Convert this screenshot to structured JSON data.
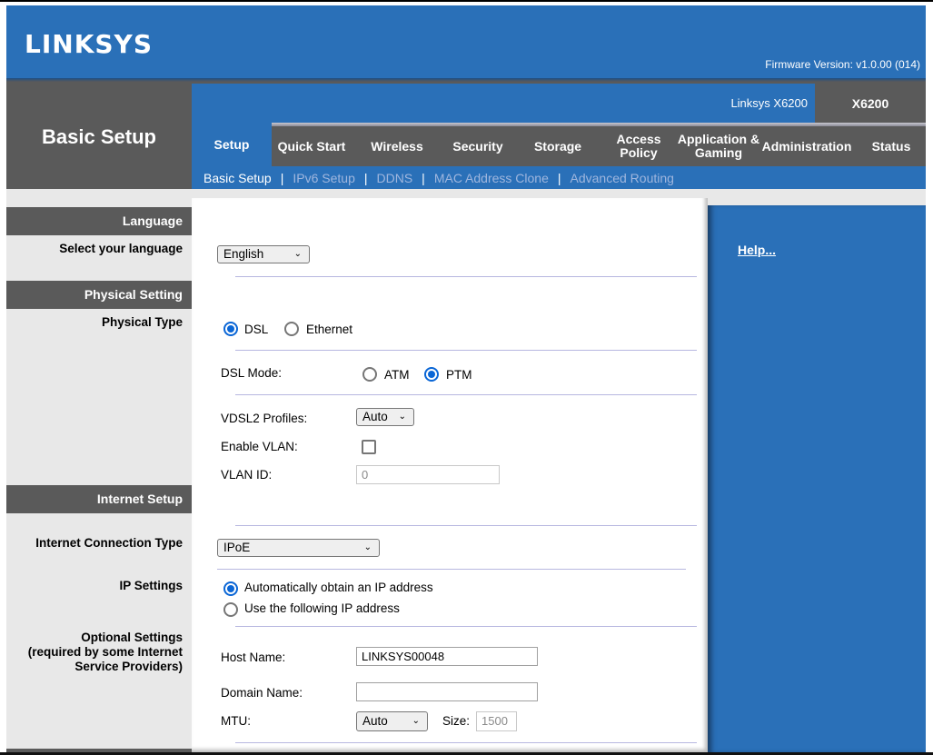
{
  "header": {
    "brand": "LINKSYS",
    "firmware": "Firmware Version: v1.0.00 (014)",
    "page_title": "Basic Setup",
    "model_name": "Linksys X6200",
    "model_short": "X6200"
  },
  "tabs": [
    {
      "label": "Setup",
      "active": true
    },
    {
      "label": "Quick Start"
    },
    {
      "label": "Wireless"
    },
    {
      "label": "Security"
    },
    {
      "label": "Storage"
    },
    {
      "label": "Access Policy"
    },
    {
      "label": "Application & Gaming"
    },
    {
      "label": "Administration"
    },
    {
      "label": "Status"
    }
  ],
  "subnav": [
    {
      "label": "Basic Setup",
      "current": true
    },
    {
      "label": "IPv6 Setup"
    },
    {
      "label": "DDNS"
    },
    {
      "label": "MAC Address Clone"
    },
    {
      "label": "Advanced Routing"
    }
  ],
  "subnav_sep": "|",
  "sections": {
    "language": "Language",
    "physical": "Physical Setting",
    "internet": "Internet Setup"
  },
  "labels": {
    "select_language": "Select your language",
    "physical_type": "Physical Type",
    "connection_type": "Internet Connection Type",
    "ip_settings": "IP Settings",
    "optional_1": "Optional Settings",
    "optional_2": "(required by some Internet",
    "optional_3": "Service Providers)"
  },
  "form": {
    "language": "English",
    "physical_type": {
      "options": [
        "DSL",
        "Ethernet"
      ],
      "selected": "DSL"
    },
    "dsl_mode_label": "DSL Mode:",
    "dsl_mode": {
      "options": [
        "ATM",
        "PTM"
      ],
      "selected": "PTM"
    },
    "vdsl2_label": "VDSL2 Profiles:",
    "vdsl2_value": "Auto",
    "enable_vlan_label": "Enable VLAN:",
    "enable_vlan": false,
    "vlan_id_label": "VLAN ID:",
    "vlan_id": "0",
    "connection_type": "IPoE",
    "ip_settings": {
      "options": [
        "Automatically obtain an IP address",
        "Use the following IP address"
      ],
      "selected": "Automatically obtain an IP address"
    },
    "host_name_label": "Host Name:",
    "host_name": "LINKSYS00048",
    "domain_name_label": "Domain Name:",
    "domain_name": "",
    "mtu_label": "MTU:",
    "mtu_value": "Auto",
    "size_label": "Size:",
    "size_value": "1500"
  },
  "help": {
    "link": "Help..."
  },
  "colors": {
    "brand_blue": "#2a70b8",
    "dark_grey": "#5a5a5a",
    "panel_grey": "#e8e8e8",
    "radio_blue": "#0a66d6"
  }
}
